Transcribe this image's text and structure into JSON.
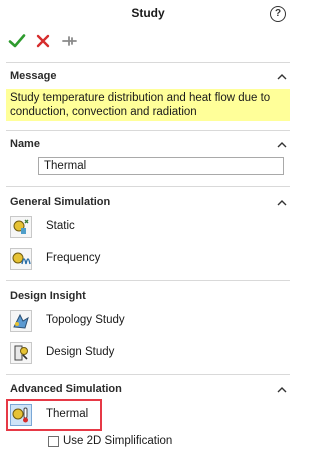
{
  "header": {
    "title": "Study",
    "help_glyph": "?",
    "actions": [
      {
        "name": "ok",
        "icon": "check-icon",
        "color": "#2e9b2e"
      },
      {
        "name": "cancel",
        "icon": "close-icon",
        "color": "#d62d2d"
      },
      {
        "name": "pin",
        "icon": "pushpin-icon",
        "color": "#8a8a8a"
      }
    ]
  },
  "message": {
    "title": "Message",
    "text": "Study temperature distribution and heat flow due to conduction, convection and radiation",
    "background": "#ffff99"
  },
  "name_section": {
    "title": "Name",
    "value": "Thermal"
  },
  "general_simulation": {
    "title": "General Simulation",
    "items": [
      {
        "label": "Static",
        "icon": "static-study-icon"
      },
      {
        "label": "Frequency",
        "icon": "frequency-study-icon"
      }
    ]
  },
  "design_insight": {
    "title": "Design Insight",
    "items": [
      {
        "label": "Topology Study",
        "icon": "topology-study-icon"
      },
      {
        "label": "Design Study",
        "icon": "design-study-icon"
      }
    ]
  },
  "advanced_simulation": {
    "title": "Advanced Simulation",
    "items": [
      {
        "label": "Thermal",
        "icon": "thermal-study-icon",
        "selected": true
      }
    ],
    "option": {
      "label": "Use 2D Simplification",
      "checked": false
    }
  },
  "colors": {
    "highlight": "#e63946",
    "divider": "#d9d9d9"
  }
}
